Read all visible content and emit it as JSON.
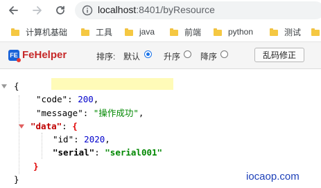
{
  "browser": {
    "url_host": "localhost",
    "url_rest": ":8401/byResource",
    "icons": {
      "back": "arrow-left-icon",
      "forward": "arrow-right-icon",
      "reload": "reload-icon",
      "info": "info-icon"
    }
  },
  "bookmarks": [
    {
      "label": "计算机基础"
    },
    {
      "label": "工具"
    },
    {
      "label": "java"
    },
    {
      "label": "前端"
    },
    {
      "label": "python"
    },
    {
      "label": "测试"
    }
  ],
  "fehelper": {
    "title": "FeHelper",
    "logo_text": "FE",
    "sort_label": "排序:",
    "sort_options": [
      {
        "label": "默认",
        "checked": true
      },
      {
        "label": "升序",
        "checked": false
      },
      {
        "label": "降序",
        "checked": false
      }
    ],
    "fix_button": "乱码修正"
  },
  "json": {
    "open_brace": "{",
    "close_brace": "}",
    "code_key": "\"code\"",
    "code_value": "200",
    "message_key": "\"message\"",
    "message_value": "\"操作成功\"",
    "data_key": "\"data\"",
    "id_key": "\"id\"",
    "id_value": "2020",
    "serial_key": "\"serial\"",
    "serial_value": "\"serial001\"",
    "colon": ": ",
    "comma": ","
  },
  "watermark": "iocaop.com",
  "colors": {
    "fehelper_title": "#c62828",
    "json_number": "#0000cc",
    "json_string": "#008800",
    "json_highlight_key": "#c00000",
    "highlight_bg": "#fffbb8"
  }
}
